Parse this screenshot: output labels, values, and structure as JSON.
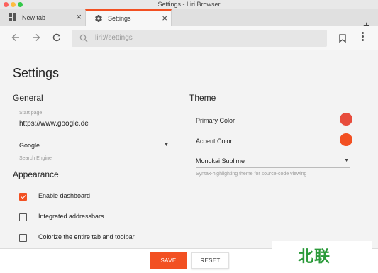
{
  "window": {
    "title": "Settings - Liri Browser"
  },
  "tabs": [
    {
      "label": "New tab",
      "icon": "grid-icon"
    },
    {
      "label": "Settings",
      "icon": "gear-icon"
    }
  ],
  "tab_close_glyph": "×",
  "new_tab_glyph": "+",
  "addressbar": {
    "url": "liri://settings"
  },
  "page": {
    "title": "Settings"
  },
  "general": {
    "heading": "General",
    "start_page_label": "Start page",
    "start_page_value": "https://www.google.de",
    "search_engine_value": "Google",
    "search_engine_help": "Search Engine"
  },
  "appearance": {
    "heading": "Appearance",
    "options": [
      {
        "label": "Enable dashboard",
        "checked": true
      },
      {
        "label": "Integrated addressbars",
        "checked": false
      },
      {
        "label": "Colorize the entire tab and toolbar",
        "checked": false
      }
    ]
  },
  "theme": {
    "heading": "Theme",
    "primary_color_label": "Primary Color",
    "primary_color": "#e74c3c",
    "accent_color_label": "Accent Color",
    "accent_color": "#f25022",
    "code_theme_value": "Monokai Sublime",
    "code_theme_help": "Syntax-highlighting theme for source-code viewing"
  },
  "actions": {
    "save_label": "SAVE",
    "reset_label": "RESET"
  },
  "watermark": {
    "text": "北联"
  }
}
